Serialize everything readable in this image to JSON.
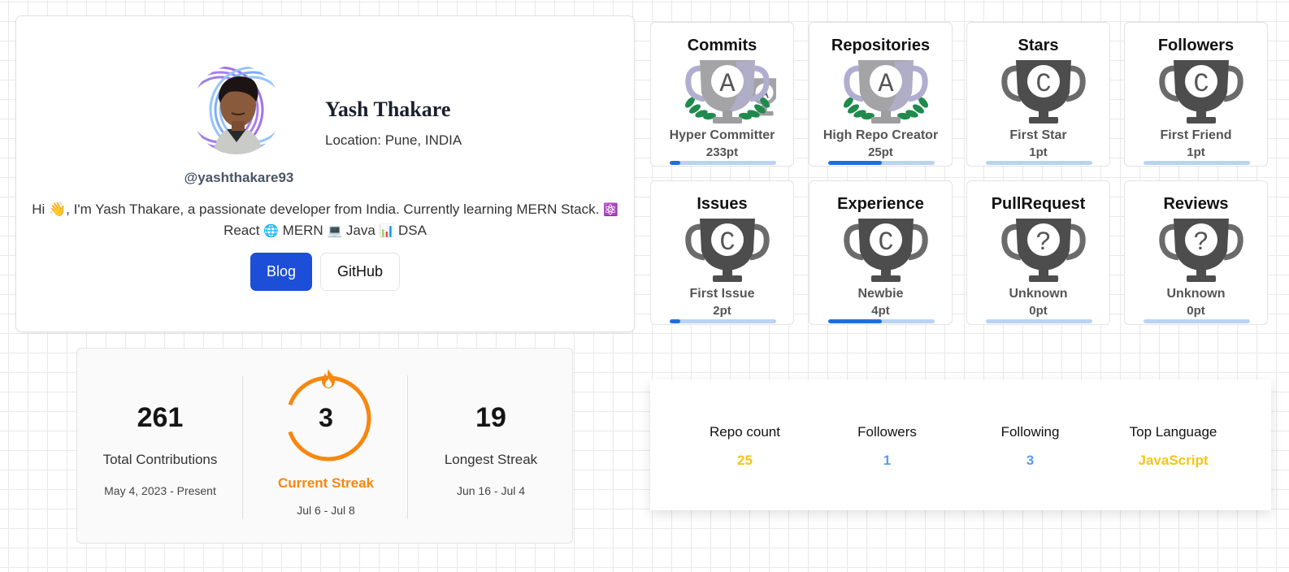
{
  "profile": {
    "name": "Yash Thakare",
    "location": "Location: Pune, INDIA",
    "username": "@yashthakare93",
    "bio_main": "Hi 👋, I'm Yash Thakare, a passionate developer from India. Currently learning MERN Stack.",
    "bio_tags": [
      "React",
      "MERN",
      "Java",
      "DSA"
    ],
    "buttons": {
      "blog": "Blog",
      "github": "GitHub"
    },
    "colors": {
      "primary_button": "#1d4ed8"
    }
  },
  "streak": {
    "total": {
      "value": "261",
      "label": "Total Contributions",
      "range": "May 4, 2023 - Present"
    },
    "current": {
      "value": "3",
      "label": "Current Streak",
      "range": "Jul 6 - Jul 8"
    },
    "longest": {
      "value": "19",
      "label": "Longest Streak",
      "range": "Jun 16 - Jul 4"
    },
    "accent_color": "#f7870e"
  },
  "trophies": [
    {
      "category": "Commits",
      "title": "Hyper Committer",
      "points": "233pt",
      "rank": "A",
      "progress": 0.1
    },
    {
      "category": "Repositories",
      "title": "High Repo Creator",
      "points": "25pt",
      "rank": "A",
      "progress": 0.5
    },
    {
      "category": "Stars",
      "title": "First Star",
      "points": "1pt",
      "rank": "C",
      "progress": 0
    },
    {
      "category": "Followers",
      "title": "First Friend",
      "points": "1pt",
      "rank": "C",
      "progress": 0
    },
    {
      "category": "Issues",
      "title": "First Issue",
      "points": "2pt",
      "rank": "C",
      "progress": 0.1
    },
    {
      "category": "Experience",
      "title": "Newbie",
      "points": "4pt",
      "rank": "C",
      "progress": 0.5
    },
    {
      "category": "PullRequest",
      "title": "Unknown",
      "points": "0pt",
      "rank": "?",
      "progress": 0
    },
    {
      "category": "Reviews",
      "title": "Unknown",
      "points": "0pt",
      "rank": "?",
      "progress": 0
    }
  ],
  "stats": [
    {
      "label": "Repo count",
      "value": "25",
      "color": "#f5c518"
    },
    {
      "label": "Followers",
      "value": "1",
      "color": "#5b9bf0"
    },
    {
      "label": "Following",
      "value": "3",
      "color": "#5b9bf0"
    },
    {
      "label": "Top Language",
      "value": "JavaScript",
      "color": "#f5c518"
    }
  ]
}
